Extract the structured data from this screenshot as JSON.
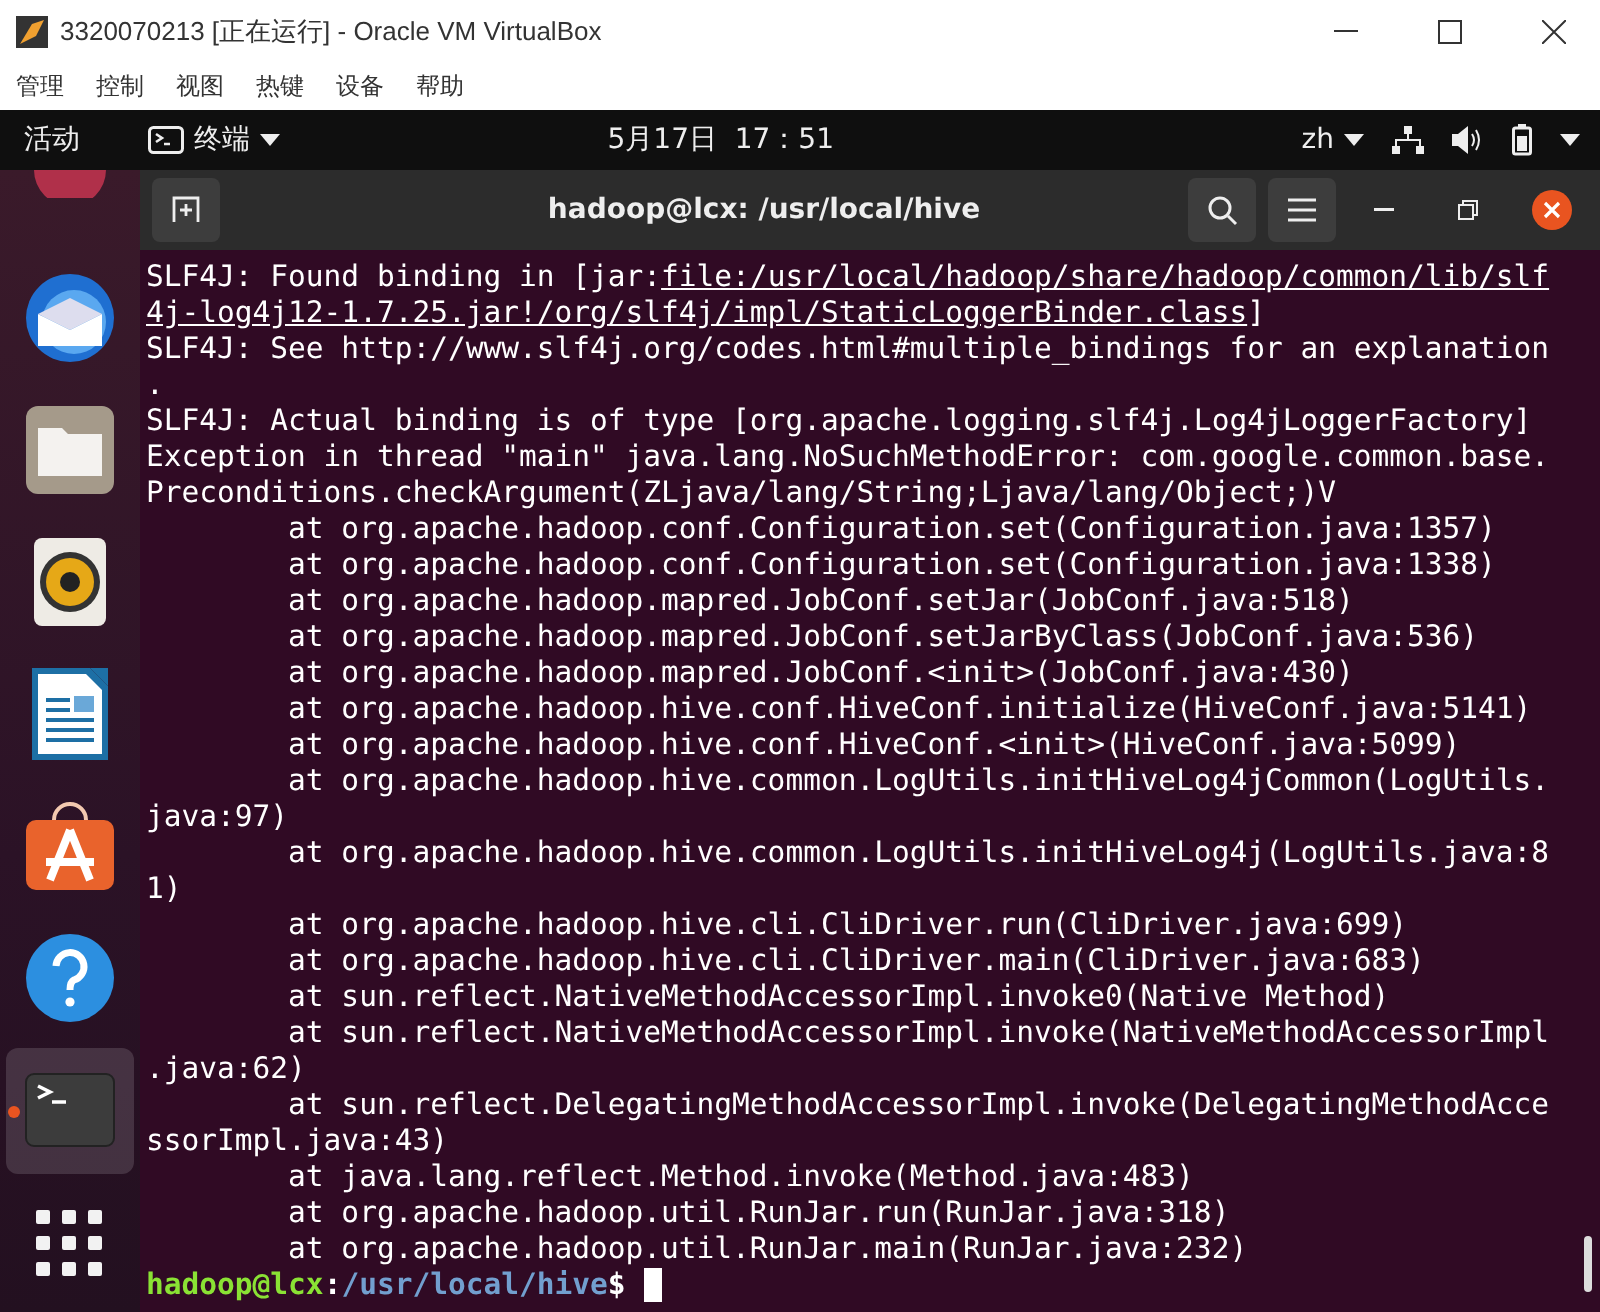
{
  "window": {
    "title": "3320070213 [正在运行] - Oracle VM VirtualBox"
  },
  "menu": [
    "管理",
    "控制",
    "视图",
    "热键",
    "设备",
    "帮助"
  ],
  "top_bar": {
    "activities": "活动",
    "app": "终端",
    "clock": "5月17日  17：51",
    "input_method": "zh"
  },
  "dock": [
    {
      "kind": "partial",
      "selected": false,
      "running": false
    },
    {
      "kind": "mail",
      "selected": false,
      "running": false
    },
    {
      "kind": "files",
      "selected": false,
      "running": false
    },
    {
      "kind": "music",
      "selected": false,
      "running": false
    },
    {
      "kind": "writer",
      "selected": false,
      "running": false
    },
    {
      "kind": "store",
      "selected": false,
      "running": false
    },
    {
      "kind": "help",
      "selected": false,
      "running": false
    },
    {
      "kind": "terminal",
      "selected": true,
      "running": true
    },
    {
      "kind": "apps",
      "selected": false,
      "running": false
    }
  ],
  "terminal": {
    "title": "hadoop@lcx: /usr/local/hive",
    "lines": [
      [
        {
          "text": "SLF4J: Found binding in [jar:"
        },
        {
          "text": "file:/usr/local/hadoop/share/hadoop/common/lib/slf",
          "link": true
        }
      ],
      [
        {
          "text": "4j-log4j12-1.7.25.jar!/org/slf4j/impl/StaticLoggerBinder.class",
          "link": true
        },
        {
          "text": "]"
        }
      ],
      [
        {
          "text": "SLF4J: See http://www.slf4j.org/codes.html#multiple_bindings for an explanation"
        }
      ],
      [
        {
          "text": "."
        }
      ],
      [
        {
          "text": "SLF4J: Actual binding is of type [org.apache.logging.slf4j.Log4jLoggerFactory]"
        }
      ],
      [
        {
          "text": "Exception in thread \"main\" java.lang.NoSuchMethodError: com.google.common.base."
        }
      ],
      [
        {
          "text": "Preconditions.checkArgument(ZLjava/lang/String;Ljava/lang/Object;)V"
        }
      ],
      [
        {
          "text": "        at org.apache.hadoop.conf.Configuration.set(Configuration.java:1357)"
        }
      ],
      [
        {
          "text": "        at org.apache.hadoop.conf.Configuration.set(Configuration.java:1338)"
        }
      ],
      [
        {
          "text": "        at org.apache.hadoop.mapred.JobConf.setJar(JobConf.java:518)"
        }
      ],
      [
        {
          "text": "        at org.apache.hadoop.mapred.JobConf.setJarByClass(JobConf.java:536)"
        }
      ],
      [
        {
          "text": "        at org.apache.hadoop.mapred.JobConf.<init>(JobConf.java:430)"
        }
      ],
      [
        {
          "text": "        at org.apache.hadoop.hive.conf.HiveConf.initialize(HiveConf.java:5141)"
        }
      ],
      [
        {
          "text": "        at org.apache.hadoop.hive.conf.HiveConf.<init>(HiveConf.java:5099)"
        }
      ],
      [
        {
          "text": "        at org.apache.hadoop.hive.common.LogUtils.initHiveLog4jCommon(LogUtils."
        }
      ],
      [
        {
          "text": "java:97)"
        }
      ],
      [
        {
          "text": "        at org.apache.hadoop.hive.common.LogUtils.initHiveLog4j(LogUtils.java:8"
        }
      ],
      [
        {
          "text": "1)"
        }
      ],
      [
        {
          "text": "        at org.apache.hadoop.hive.cli.CliDriver.run(CliDriver.java:699)"
        }
      ],
      [
        {
          "text": "        at org.apache.hadoop.hive.cli.CliDriver.main(CliDriver.java:683)"
        }
      ],
      [
        {
          "text": "        at sun.reflect.NativeMethodAccessorImpl.invoke0(Native Method)"
        }
      ],
      [
        {
          "text": "        at sun.reflect.NativeMethodAccessorImpl.invoke(NativeMethodAccessorImpl"
        }
      ],
      [
        {
          "text": ".java:62)"
        }
      ],
      [
        {
          "text": "        at sun.reflect.DelegatingMethodAccessorImpl.invoke(DelegatingMethodAcce"
        }
      ],
      [
        {
          "text": "ssorImpl.java:43)"
        }
      ],
      [
        {
          "text": "        at java.lang.reflect.Method.invoke(Method.java:483)"
        }
      ],
      [
        {
          "text": "        at org.apache.hadoop.util.RunJar.run(RunJar.java:318)"
        }
      ],
      [
        {
          "text": "        at org.apache.hadoop.util.RunJar.main(RunJar.java:232)"
        }
      ]
    ],
    "prompt": {
      "user": "hadoop@lcx",
      "separator": ":",
      "path": "/usr/local/hive",
      "symbol": "$"
    }
  }
}
